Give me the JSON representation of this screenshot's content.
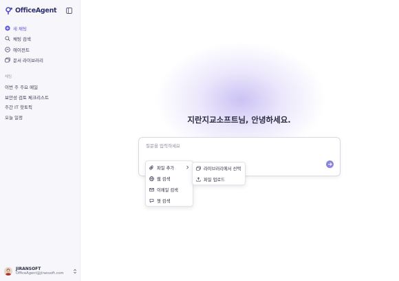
{
  "app": {
    "brand": "OfficeAgent"
  },
  "sidebar": {
    "nav": [
      {
        "label": "새 채팅",
        "icon": "plus-circle-icon"
      },
      {
        "label": "채팅 검색",
        "icon": "search-icon"
      },
      {
        "label": "에이전트",
        "icon": "agent-icon"
      },
      {
        "label": "문서 라이브러리",
        "icon": "library-icon"
      }
    ],
    "section_label": "채팅",
    "recent": [
      "이번 주 주요 메일",
      "보안성 검토 체크리스트",
      "주간 IT 핫토픽",
      "오늘 일정"
    ],
    "user": {
      "name": "JIRANSOFT",
      "email": "OfficeAgent@jiransoft.com"
    }
  },
  "main": {
    "greeting": "지란지교소프트님, 안녕하세요.",
    "input_placeholder": "질문을 입력하세요",
    "menu": [
      {
        "label": "파일 추가",
        "icon": "paperclip-icon"
      },
      {
        "label": "웹 검색",
        "icon": "globe-icon"
      },
      {
        "label": "이메일 검색",
        "icon": "mail-icon"
      },
      {
        "label": "챗 검색",
        "icon": "chat-icon"
      }
    ],
    "submenu": [
      {
        "label": "라이브러리에서 선택",
        "icon": "library-icon"
      },
      {
        "label": "파일 업로드",
        "icon": "upload-icon"
      }
    ]
  },
  "colors": {
    "accent": "#5b53d6",
    "send_button": "#8a86e0",
    "sidebar_bg": "#f7f7fb"
  }
}
